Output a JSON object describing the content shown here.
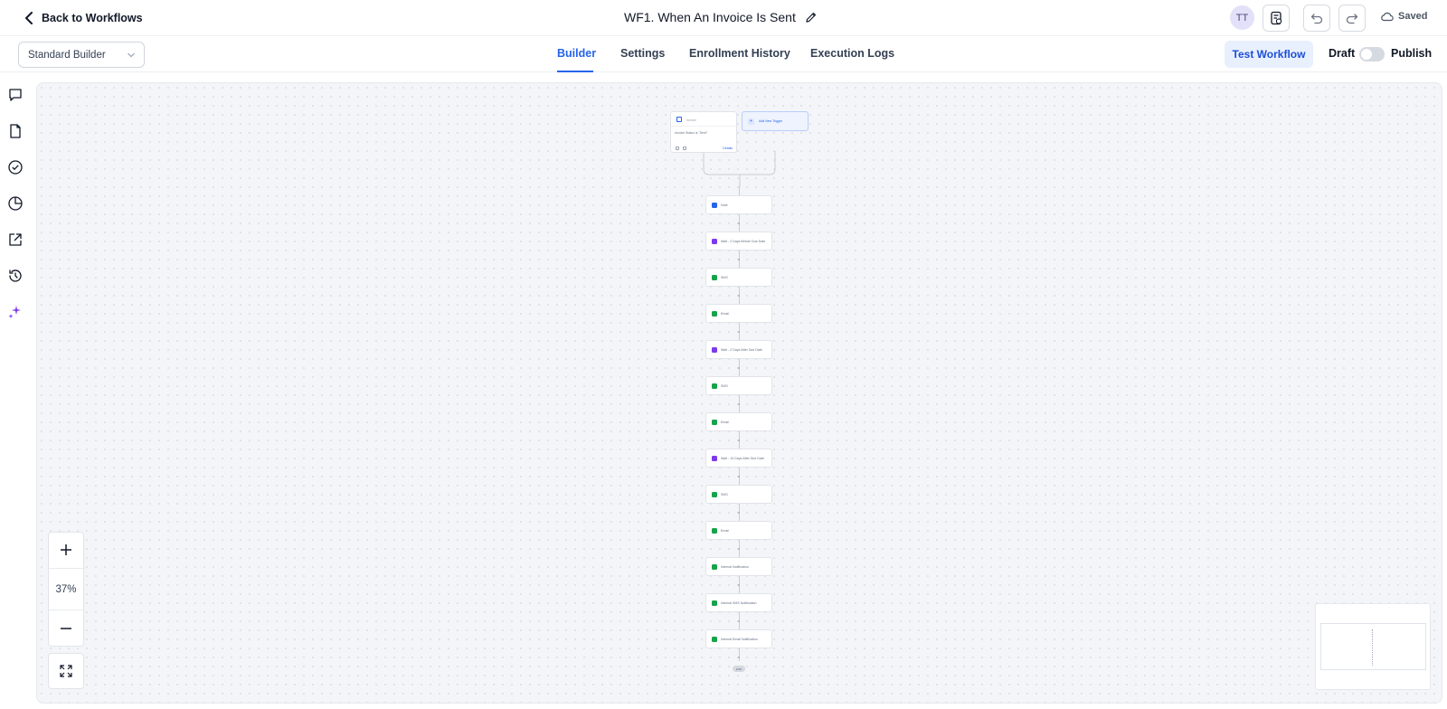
{
  "header": {
    "back_label": "Back to Workflows",
    "title": "WF1. When An Invoice Is Sent",
    "avatar_initials": "TT",
    "saved_label": "Saved"
  },
  "toolbar": {
    "builder_select": "Standard Builder",
    "tabs": [
      {
        "label": "Builder",
        "active": true
      },
      {
        "label": "Settings",
        "active": false
      },
      {
        "label": "Enrollment History",
        "active": false
      },
      {
        "label": "Execution Logs",
        "active": false
      }
    ],
    "test_button": "Test Workflow",
    "draft_label": "Draft",
    "publish_label": "Publish",
    "publish_on": false
  },
  "left_rail": [
    "chat-icon",
    "document-icon",
    "check-circle-icon",
    "pie-chart-icon",
    "external-link-icon",
    "history-icon",
    "sparkles-icon"
  ],
  "canvas": {
    "trigger": {
      "label": "Invoice",
      "filter": "Invoice Status is \"Sent\"",
      "details_link": "Details"
    },
    "add_trigger_label": "Add New Trigger",
    "steps": [
      {
        "label": "Note",
        "color": "#2563eb"
      },
      {
        "label": "Wait - 2 Days Before Due Date",
        "color": "#7c3aed"
      },
      {
        "label": "SMS",
        "color": "#16a34a"
      },
      {
        "label": "Email",
        "color": "#16a34a"
      },
      {
        "label": "Wait - 2 Days After Due Date",
        "color": "#7c3aed"
      },
      {
        "label": "SMS",
        "color": "#16a34a"
      },
      {
        "label": "Email",
        "color": "#16a34a"
      },
      {
        "label": "Wait - 10 Days After Due Date",
        "color": "#7c3aed"
      },
      {
        "label": "SMS",
        "color": "#16a34a"
      },
      {
        "label": "Email",
        "color": "#16a34a"
      },
      {
        "label": "Internal Notification",
        "color": "#16a34a"
      },
      {
        "label": "Internal SMS Notification",
        "color": "#16a34a"
      },
      {
        "label": "Internal Email Notification",
        "color": "#16a34a"
      }
    ],
    "end_label": "END"
  },
  "zoom": {
    "level": "37%"
  },
  "colors": {
    "accent": "#2563eb",
    "canvas_bg": "#f4f5f8"
  }
}
